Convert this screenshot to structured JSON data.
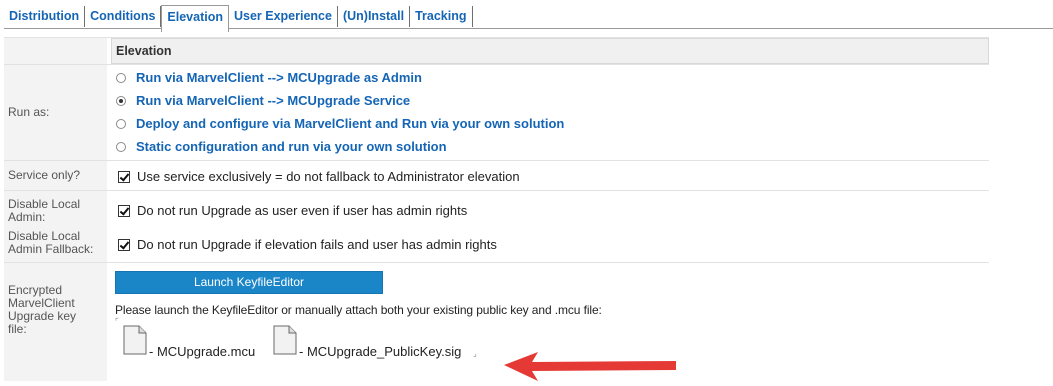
{
  "tabs": [
    {
      "label": "Distribution"
    },
    {
      "label": "Conditions"
    },
    {
      "label": "Elevation"
    },
    {
      "label": "User Experience"
    },
    {
      "label": "(Un)Install"
    },
    {
      "label": "Tracking"
    }
  ],
  "active_tab": "Elevation",
  "section_header": "Elevation",
  "run_as": {
    "label": "Run as:",
    "selected_index": 1,
    "options": [
      "Run via MarvelClient --> MCUpgrade as Admin",
      "Run via MarvelClient --> MCUpgrade Service",
      "Deploy and configure via MarvelClient and Run via your own solution",
      "Static configuration and run via your own solution"
    ]
  },
  "service_only": {
    "label": "Service only?",
    "checked": true,
    "text": "Use service exclusively = do not fallback to Administrator elevation"
  },
  "disable_local_admin": {
    "label_line1": "Disable Local",
    "label_line2": "Admin:",
    "checked": true,
    "text": "Do not run Upgrade as user even if user has admin rights"
  },
  "disable_local_admin_fallback": {
    "label_line1": "Disable Local",
    "label_line2": "Admin Fallback:",
    "checked": true,
    "text": "Do not run Upgrade if elevation fails and user has admin rights"
  },
  "key_file": {
    "label_line1": "Encrypted",
    "label_line2": "MarvelClient",
    "label_line3": "Upgrade key",
    "label_line4": "file:",
    "button_label": "Launch KeyfileEditor",
    "note": "Please launch the KeyfileEditor or manually attach both your existing public key and .mcu file:",
    "attachments": [
      {
        "name": "- MCUpgrade.mcu",
        "icon": "document-icon"
      },
      {
        "name": "- MCUpgrade_PublicKey.sig",
        "icon": "document-icon"
      }
    ]
  },
  "colors": {
    "link_blue": "#1565b5",
    "button_blue": "#1a85c7",
    "arrow_red": "#e53935",
    "label_bg": "#f3f3f3"
  }
}
